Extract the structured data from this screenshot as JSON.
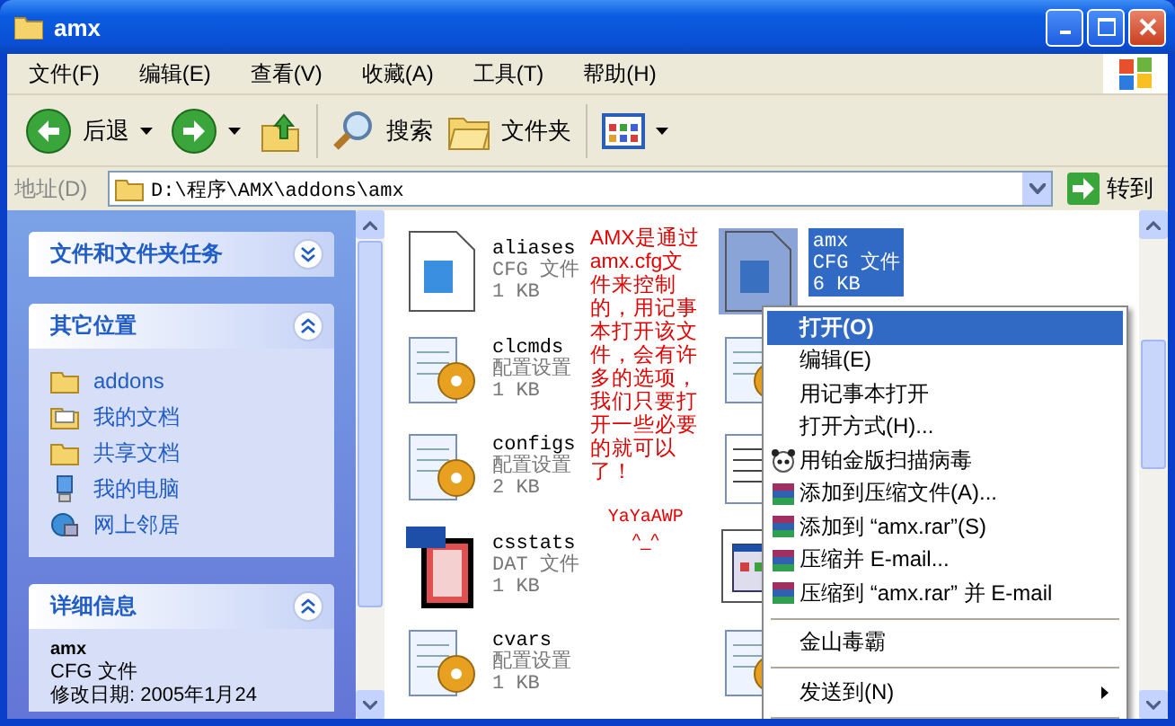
{
  "window": {
    "title": "amx"
  },
  "menu": [
    "文件(F)",
    "编辑(E)",
    "查看(V)",
    "收藏(A)",
    "工具(T)",
    "帮助(H)"
  ],
  "toolbar": {
    "back": "后退",
    "search": "搜索",
    "folders": "文件夹"
  },
  "address": {
    "label": "地址(D)",
    "value": "D:\\程序\\AMX\\addons\\amx",
    "go": "转到"
  },
  "sidebar": [
    {
      "kind": "tasks",
      "title": "文件和文件夹任务",
      "expanded": false
    },
    {
      "kind": "places",
      "title": "其它位置",
      "expanded": true,
      "items": [
        {
          "label": "addons",
          "kind": "folder"
        },
        {
          "label": "我的文档",
          "kind": "documents"
        },
        {
          "label": "共享文档",
          "kind": "folder"
        },
        {
          "label": "我的电脑",
          "kind": "computer"
        },
        {
          "label": "网上邻居",
          "kind": "network"
        }
      ]
    },
    {
      "kind": "details",
      "title": "详细信息",
      "expanded": true,
      "name": "amx",
      "type": "CFG 文件",
      "modified": "修改日期: 2005年1月24"
    }
  ],
  "files": [
    {
      "name": "aliases",
      "type": "CFG 文件",
      "size": "1 KB",
      "kind": "cfg"
    },
    {
      "name": "clcmds",
      "type": "配置设置",
      "size": "1 KB",
      "kind": "config"
    },
    {
      "name": "configs",
      "type": "配置设置",
      "size": "2 KB",
      "kind": "config"
    },
    {
      "name": "csstats",
      "type": "DAT 文件",
      "size": "1 KB",
      "kind": "dat"
    },
    {
      "name": "cvars",
      "type": "配置设置",
      "size": "1 KB",
      "kind": "config"
    }
  ],
  "files_column_2": [
    {
      "name": "amx",
      "type": "CFG 文件",
      "size": "6 KB",
      "kind": "cfg",
      "selected": true
    },
    {
      "kind": "config",
      "selected": false
    },
    {
      "kind": "text",
      "selected": false
    },
    {
      "kind": "app",
      "selected": false
    },
    {
      "kind": "config",
      "selected": false
    }
  ],
  "annotation": {
    "text": "AMX是通过amx.cfg文件来控制的，用记事本打开该文件，会有许多的选项，我们只要打开一些必要的就可以了！",
    "signature": "YaYaAWP",
    "smiley": "^_^"
  },
  "context_menu": [
    {
      "kind": "item",
      "label": "打开(O)",
      "selected": true
    },
    {
      "kind": "item",
      "label": "编辑(E)",
      "selected": false
    },
    {
      "kind": "item",
      "label": "用记事本打开",
      "selected": false
    },
    {
      "kind": "item",
      "label": "打开方式(H)...",
      "selected": false
    },
    {
      "kind": "scan",
      "label": "用铂金版扫描病毒",
      "selected": false
    },
    {
      "kind": "archive",
      "label": "添加到压缩文件(A)...",
      "selected": false
    },
    {
      "kind": "archive",
      "label": "添加到 “amx.rar”(S)",
      "selected": false
    },
    {
      "kind": "archive",
      "label": "压缩并 E-mail...",
      "selected": false
    },
    {
      "kind": "archive",
      "label": "压缩到 “amx.rar” 并 E-mail",
      "selected": false
    },
    {
      "kind": "separator"
    },
    {
      "kind": "item",
      "label": "金山毒霸",
      "selected": false
    },
    {
      "kind": "separator"
    },
    {
      "kind": "submenu",
      "label": "发送到(N)",
      "selected": false
    },
    {
      "kind": "separator"
    }
  ]
}
